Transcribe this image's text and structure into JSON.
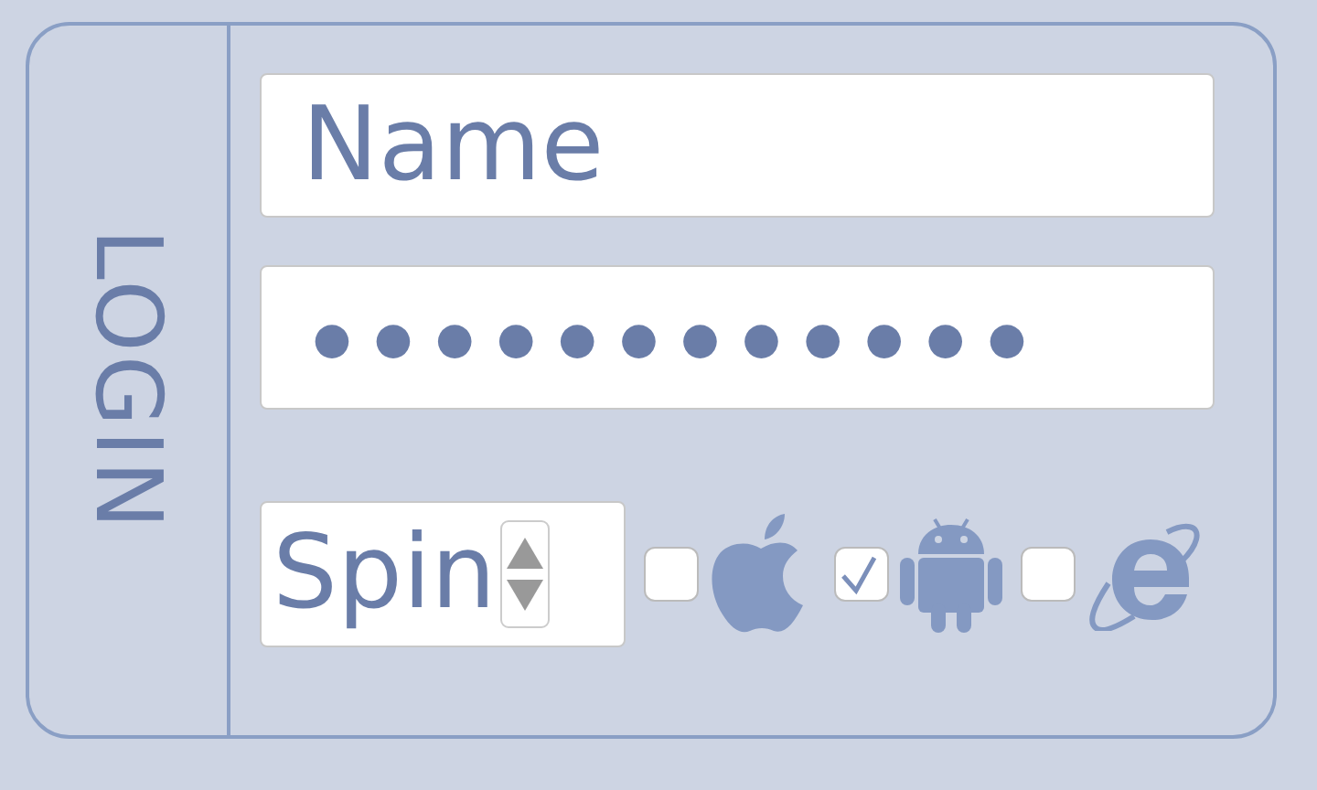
{
  "side_label": "LOGIN",
  "name_field": {
    "placeholder": "Name"
  },
  "password_field": {
    "value": "●●●●●●●●●●●●"
  },
  "spinner": {
    "value": "Spin"
  },
  "platforms": [
    {
      "kind": "apple",
      "checked": false
    },
    {
      "kind": "android",
      "checked": true
    },
    {
      "kind": "ie",
      "checked": false
    }
  ]
}
